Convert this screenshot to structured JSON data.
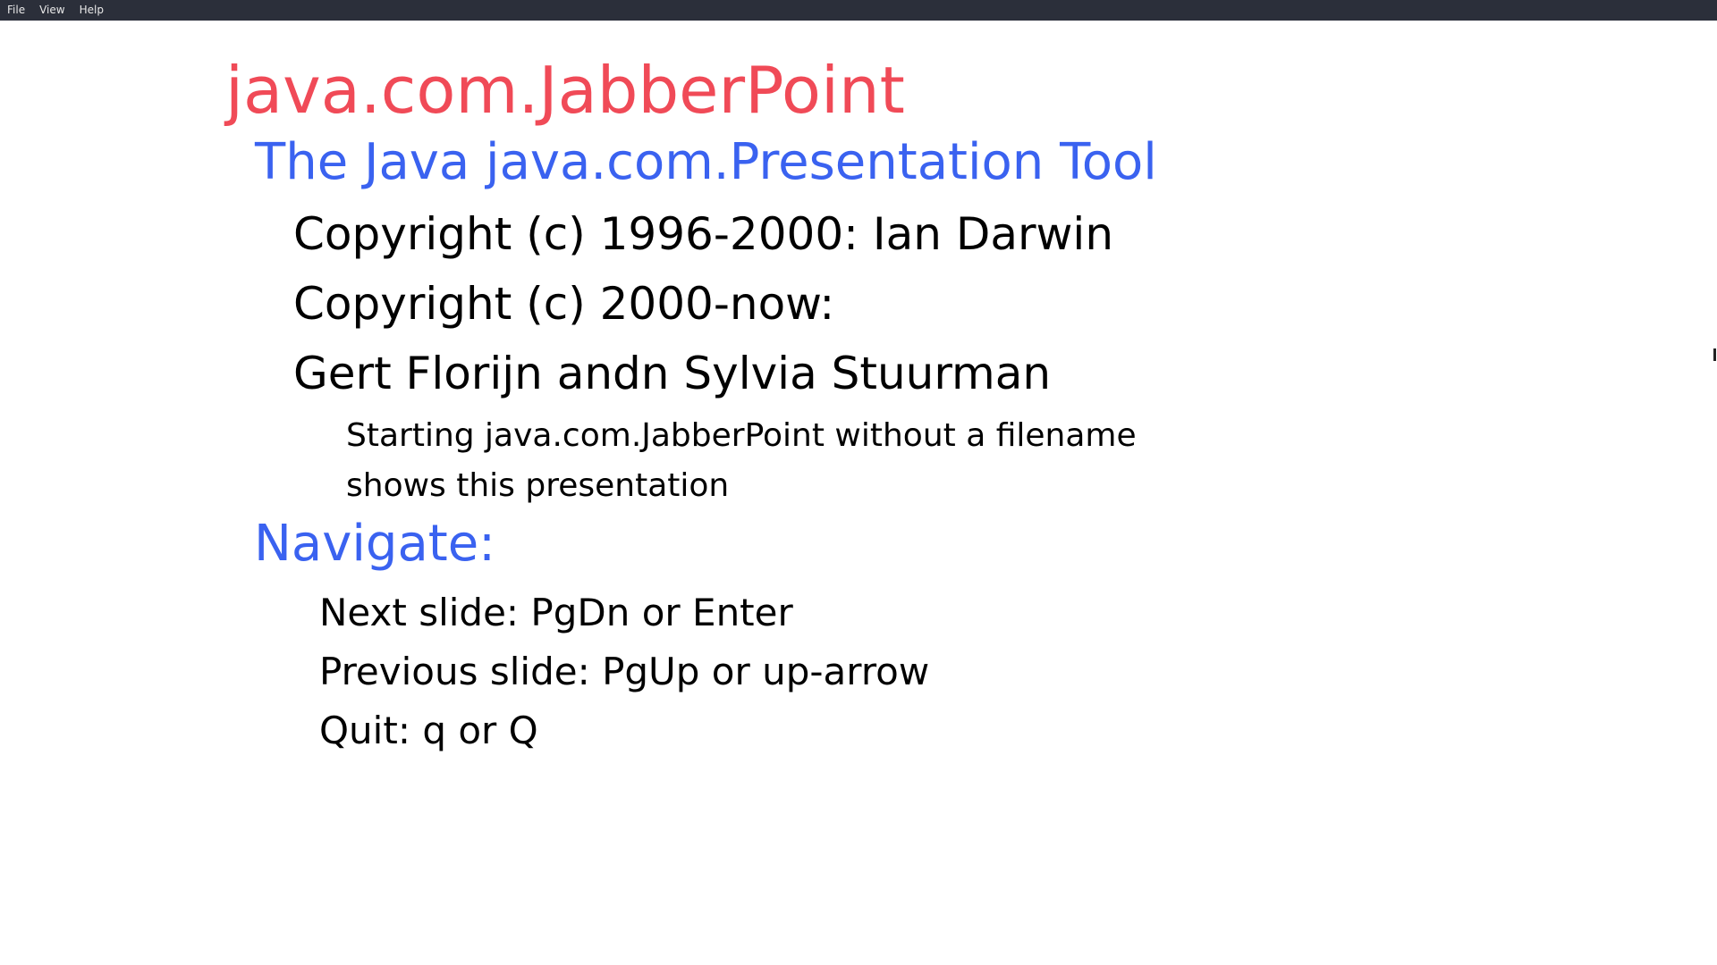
{
  "menu": {
    "items": [
      {
        "label": "File"
      },
      {
        "label": "View"
      },
      {
        "label": "Help"
      }
    ]
  },
  "slide": {
    "title": "java.com.JabberPoint",
    "subtitle": "The Java java.com.Presentation Tool",
    "copyright1": "Copyright (c) 1996-2000: Ian Darwin",
    "copyright2": "Copyright (c) 2000-now:",
    "authors": "Gert Florijn andn Sylvia Stuurman",
    "note1": "Starting java.com.JabberPoint without a filename",
    "note2": "shows this presentation",
    "navigate_heading": "Navigate:",
    "nav_next": "Next slide: PgDn or Enter",
    "nav_prev": "Previous slide: PgUp or up-arrow",
    "nav_quit": "Quit: q or Q"
  },
  "colors": {
    "menubar_bg": "#2b2f3a",
    "title": "#f04a57",
    "heading": "#3a62f0",
    "text": "#000000"
  }
}
